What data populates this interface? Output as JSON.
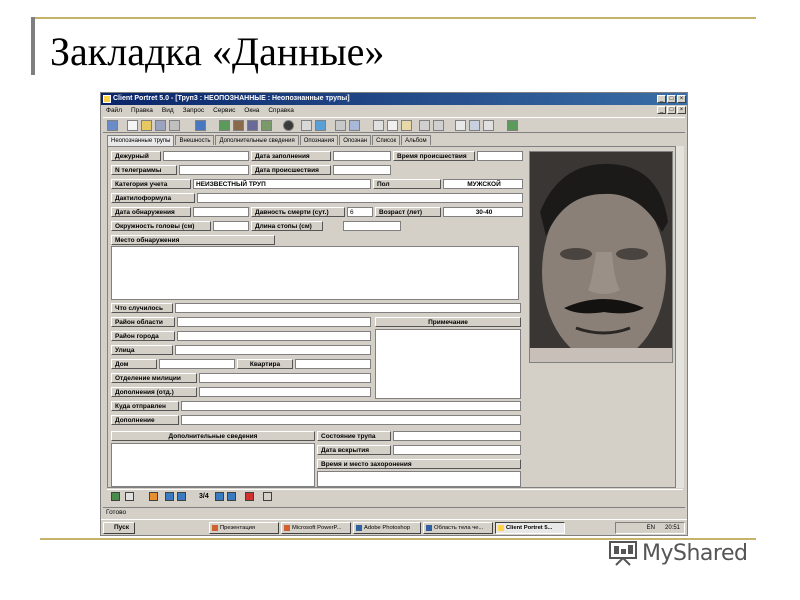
{
  "slide": {
    "title": "Закладка «Данные»",
    "brand": "MyShared"
  },
  "window": {
    "title": "Client Portret 5.0 - [Труп3 : НЕОПОЗНАННЫЕ : Неопознанные трупы]",
    "menu": [
      "Файл",
      "Правка",
      "Вид",
      "Запрос",
      "Сервис",
      "Окна",
      "Справка"
    ],
    "tabs": [
      "Неопознанные трупы",
      "Внешность",
      "Дополнительные сведения",
      "Опознания",
      "Опознан",
      "Список",
      "Альбом"
    ]
  },
  "form": {
    "duty_label": "Дежурный",
    "duty_value": "",
    "date_fill_label": "Дата заполнения",
    "date_fill_value": "",
    "time_incident_label": "Время происшествия",
    "time_incident_value": "",
    "telegram_label": "N телеграммы",
    "telegram_value": "",
    "date_incident_label": "Дата происшествия",
    "date_incident_value": "",
    "category_label": "Категория учета",
    "category_value": "НЕИЗВЕСТНЫЙ ТРУП",
    "sex_label": "Пол",
    "sex_value": "МУЖСКОЙ",
    "dactylo_label": "Дактилоформула",
    "dactylo_value": "",
    "date_found_label": "Дата обнаружения",
    "date_found_value": "",
    "death_age_label": "Давность смерти (сут.)",
    "death_age_value": "6",
    "age_label": "Возраст (лет)",
    "age_value": "30-40",
    "head_label": "Окружность головы (см)",
    "head_value": "",
    "foot_label": "Длина стопы (см)",
    "foot_value": "",
    "place_found_label": "Место обнаружения",
    "what_happened_label": "Что случилось",
    "district_region_label": "Район области",
    "district_city_label": "Район города",
    "note_label": "Примечание",
    "street_label": "Улица",
    "house_label": "Дом",
    "flat_label": "Квартира",
    "police_label": "Отделение милиции",
    "addition_dept_label": "Дополнения (отд.)",
    "sent_label": "Куда отправлен",
    "addition_label": "Дополнение",
    "extra_info_label": "Дополнительные сведения",
    "corpse_state_label": "Состояние трупа",
    "autopsy_label": "Дата вскрытия",
    "burial_label": "Время и место захоронения"
  },
  "navigation": {
    "record_counter": "3/4"
  },
  "status": {
    "text": "Готово"
  },
  "taskbar": {
    "start": "Пуск",
    "tasks": [
      "Презентация",
      "Microsoft PowerP...",
      "Adobe Photoshop",
      "Область тела че...",
      "Client Portret 5..."
    ],
    "clock": "20:51",
    "lang": "EN"
  },
  "colors": {
    "accent_line": "#c6b36b",
    "titlebar": "#0a246a",
    "window_bg": "#d4d0c8"
  }
}
